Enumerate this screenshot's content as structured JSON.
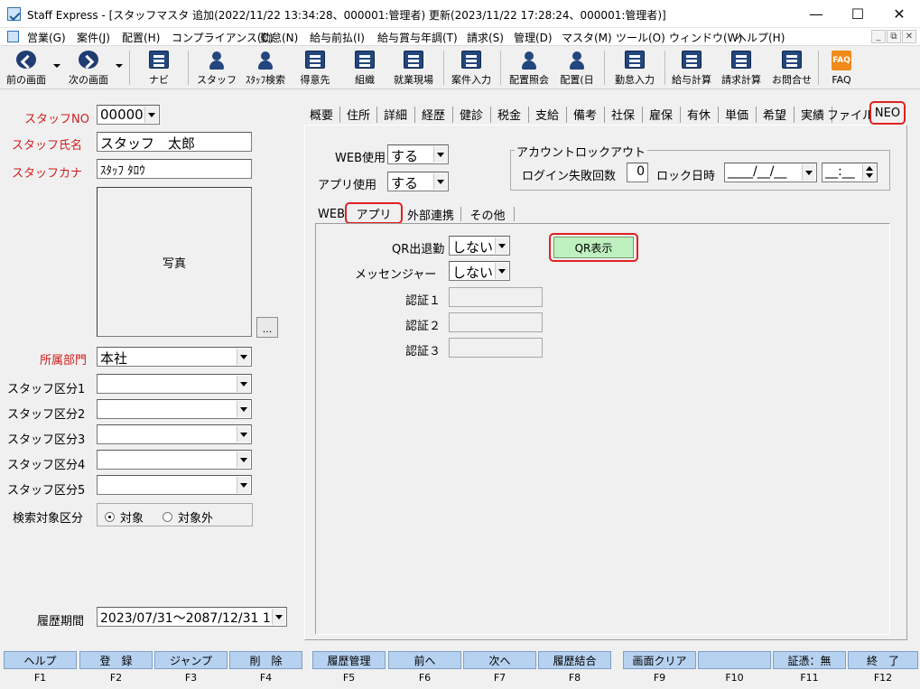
{
  "window": {
    "title": "Staff Express - [スタッフマスタ 追加(2022/11/22 13:34:28、000001:管理者) 更新(2023/11/22 17:28:24、000001:管理者)]",
    "minimize": "—",
    "maximize": "☐",
    "close": "✕"
  },
  "menu": [
    "営業(G)",
    "案件(J)",
    "配置(H)",
    "コンプライアンス(C)",
    "勤怠(N)",
    "給与前払(I)",
    "給与賞与年調(T)",
    "請求(S)",
    "管理(D)",
    "マスタ(M)",
    "ツール(O)",
    "ウィンドウ(W)",
    "ヘルプ(H)"
  ],
  "mdi": {
    "minimize": "_",
    "restore": "⧉",
    "close": "✕"
  },
  "toolbar": {
    "prev": "前の画面",
    "next": "次の画面",
    "navi": "ナビ",
    "staff": "スタッフ",
    "staff_search": "ｽﾀｯﾌ検索",
    "client": "得意先",
    "org": "組織",
    "site": "就業現場",
    "case_entry": "案件入力",
    "assign_ref": "配置照会",
    "assign_day": "配置(日",
    "attendance": "勤怠入力",
    "payroll": "給与計算",
    "billing": "請求計算",
    "inquiry": "お問合せ",
    "faq": "FAQ",
    "faq_icon_text": "FAQ"
  },
  "left": {
    "staff_no_label": "スタッフNO",
    "staff_no_value": "000005",
    "staff_name_label": "スタッフ氏名",
    "staff_name_value": "スタッフ　太郎",
    "staff_kana_label": "スタッフカナ",
    "staff_kana_value": "ｽﾀｯﾌ ﾀﾛｳ",
    "photo_label": "写真",
    "photo_btn": "...",
    "dept_label": "所属部門",
    "dept_value": "本社",
    "cat1_label": "スタッフ区分1",
    "cat2_label": "スタッフ区分2",
    "cat3_label": "スタッフ区分3",
    "cat4_label": "スタッフ区分4",
    "cat5_label": "スタッフ区分5",
    "search_target_label": "検索対象区分",
    "target_on": "対象",
    "target_off": "対象外",
    "history_label": "履歴期間",
    "history_value": "2023/07/31～2087/12/31 1"
  },
  "tabs": [
    "概要",
    "住所",
    "詳細",
    "経歴",
    "健診",
    "税金",
    "支給",
    "備考",
    "社保",
    "雇保",
    "有休",
    "単価",
    "希望",
    "実績",
    "ファイル",
    "NEO"
  ],
  "neo": {
    "web_use_label": "WEB使用",
    "web_use_value": "する",
    "app_use_label": "アプリ使用",
    "app_use_value": "する",
    "lockout_title": "アカウントロックアウト",
    "login_fail_label": "ログイン失敗回数",
    "login_fail_value": "0",
    "lock_date_label": "ロック日時",
    "lock_date_value": "____/__/__",
    "lock_time_value": "__:__",
    "subtabs": [
      "WEB",
      "アプリ",
      "外部連携",
      "その他"
    ],
    "qr_attendance_label": "QR出退勤",
    "qr_attendance_value": "しない",
    "messenger_label": "メッセンジャー",
    "messenger_value": "しない",
    "auth1_label": "認証１",
    "auth2_label": "認証２",
    "auth3_label": "認証３",
    "qr_button": "QR表示"
  },
  "fkeys": [
    {
      "label": "ヘルプ",
      "key": "F1"
    },
    {
      "label": "登　録",
      "key": "F2"
    },
    {
      "label": "ジャンプ",
      "key": "F3"
    },
    {
      "label": "削　除",
      "key": "F4"
    },
    {
      "label": "履歴管理",
      "key": "F5"
    },
    {
      "label": "前へ",
      "key": "F6"
    },
    {
      "label": "次へ",
      "key": "F7"
    },
    {
      "label": "履歴結合",
      "key": "F8"
    },
    {
      "label": "画面クリア",
      "key": "F9"
    },
    {
      "label": "",
      "key": "F10"
    },
    {
      "label": "証憑：無",
      "key": "F11"
    },
    {
      "label": "終　了",
      "key": "F12"
    }
  ]
}
